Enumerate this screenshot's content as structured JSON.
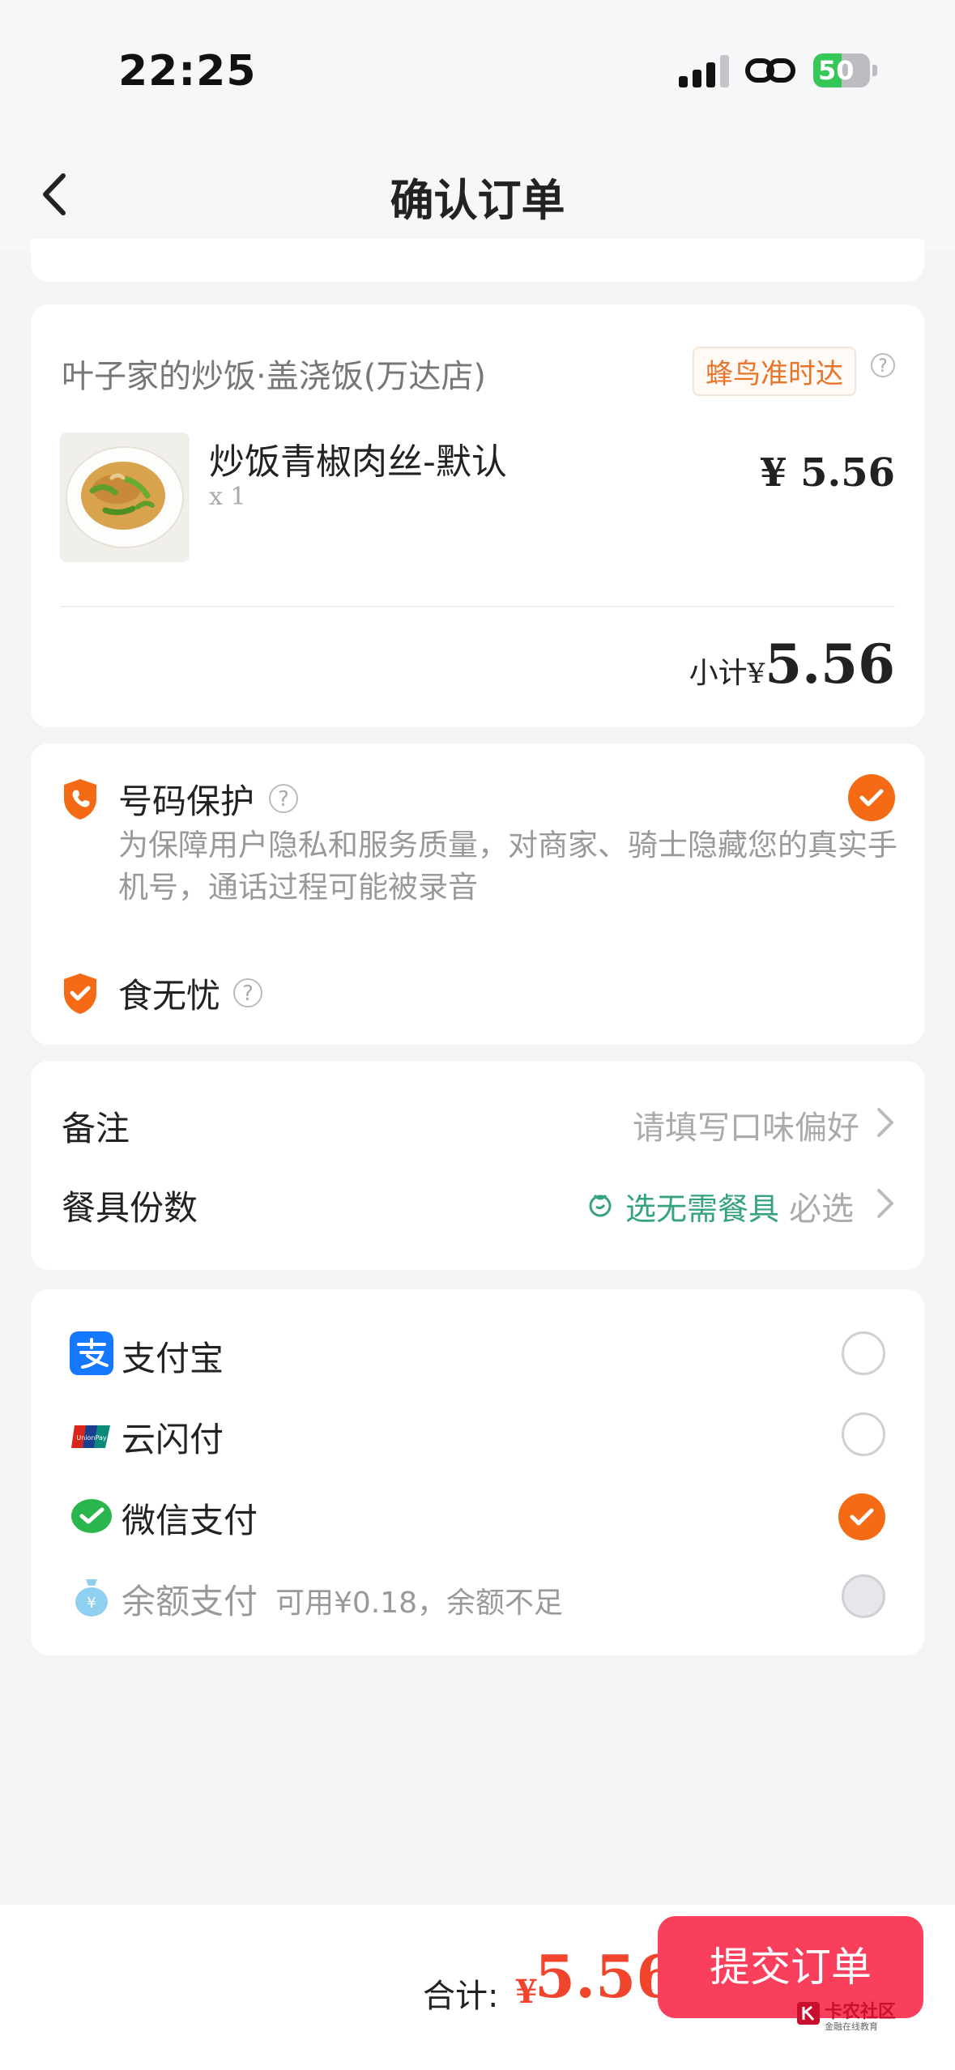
{
  "status": {
    "time": "22:25",
    "battery": "50"
  },
  "nav": {
    "title": "确认订单"
  },
  "order": {
    "store_name": "叶子家的炒饭·盖浇饭(万达店)",
    "delivery_badge": "蜂鸟准时达",
    "item_name": "炒饭青椒肉丝-默认",
    "item_qty": "x 1",
    "item_price": "¥ 5.56",
    "subtotal_label": "小计",
    "subtotal_currency": "¥",
    "subtotal_amount": "5.56"
  },
  "services": {
    "number_protection_title": "号码保护",
    "number_protection_desc": "为保障用户隐私和服务质量，对商家、骑士隐藏您的真实手机号，通话过程可能被录音",
    "number_protection_checked": true,
    "food_worry_free_title": "食无忧"
  },
  "notes": {
    "remark_label": "备注",
    "remark_placeholder": "请填写口味偏好",
    "tableware_label": "餐具份数",
    "tableware_option": "选无需餐具",
    "tableware_required": "必选"
  },
  "payment": {
    "methods": [
      {
        "label": "支付宝",
        "icon": "alipay-icon",
        "selected": false
      },
      {
        "label": "云闪付",
        "icon": "unionpay-icon",
        "selected": false
      },
      {
        "label": "微信支付",
        "icon": "wechat-pay-icon",
        "selected": true
      },
      {
        "label": "余额支付",
        "icon": "balance-icon",
        "selected": false,
        "disabled": true,
        "note": "可用¥0.18，余额不足"
      }
    ]
  },
  "footer": {
    "total_label": "合计:",
    "total_currency": "¥",
    "total_amount": "5.56",
    "submit_label": "提交订单"
  },
  "watermark": {
    "text": "卡农社区",
    "sub": "金融在线教育"
  },
  "colors": {
    "accent_orange": "#f56a14",
    "price_red": "#f0442d",
    "submit_pink": "#fa3f5c",
    "wechat_green": "#2ab64d",
    "alipay_blue": "#1677ff"
  }
}
